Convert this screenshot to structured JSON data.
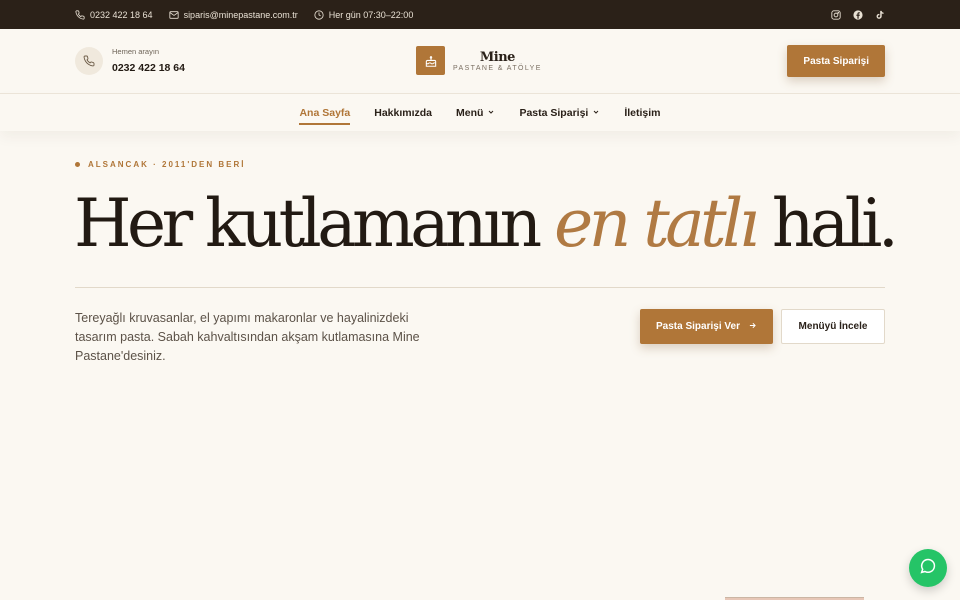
{
  "topbar": {
    "phone": "0232 422 18 64",
    "email": "siparis@minepastane.com.tr",
    "hours": "Her gün 07:30–22:00",
    "social": [
      "instagram-icon",
      "facebook-icon",
      "tiktok-icon"
    ]
  },
  "header": {
    "call_label": "Hemen arayın",
    "call_number": "0232 422 18 64",
    "brand_name": "Mine",
    "brand_sub": "PASTANE & ATÖLYE",
    "order_button": "Pasta Siparişi"
  },
  "nav": {
    "items": [
      {
        "label": "Ana Sayfa"
      },
      {
        "label": "Hakkımızda"
      },
      {
        "label": "Menü"
      },
      {
        "label": "Pasta Siparişi"
      },
      {
        "label": "İletişim"
      }
    ]
  },
  "hero": {
    "eyebrow": "ALSANCAK · 2011'DEN BERİ",
    "headline_before": "Her kutlamanın",
    "headline_accent": "en tatlı",
    "headline_after": "hali.",
    "description": "Tereyağlı kruvasanlar, el yapımı makaronlar ve hayalinizdeki tasarım pasta. Sabah kahvaltısından akşam kutlamasına Mine Pastane'desiniz.",
    "primary_cta": "Pasta Siparişi Ver",
    "secondary_cta": "Menüyü İncele"
  },
  "colors": {
    "accent": "#b07638",
    "topbar_bg": "#2b2118",
    "page_bg": "#fbf8f2",
    "chat_bg": "#25c467"
  }
}
